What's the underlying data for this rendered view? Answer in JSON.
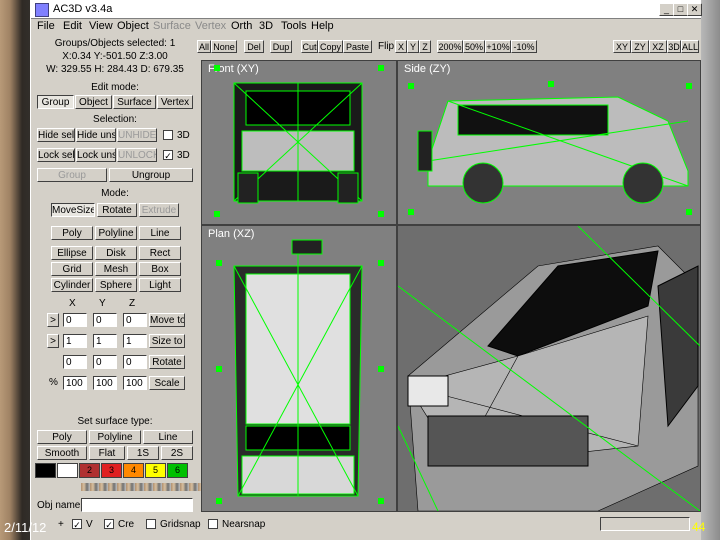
{
  "window": {
    "title": "AC3D v3.4a"
  },
  "menu": [
    "File",
    "Edit",
    "View",
    "Object",
    "Surface",
    "Vertex",
    "Orth",
    "3D",
    "Tools",
    "Help"
  ],
  "info": {
    "selected": "Groups/Objects selected: 1",
    "coords": "X:0.34 Y:-501.50 Z:3.00",
    "size": "W: 329.55 H: 284.43 D: 679.35"
  },
  "edit_mode": {
    "label": "Edit mode:",
    "buttons": [
      "Group",
      "Object",
      "Surface",
      "Vertex"
    ]
  },
  "selection": {
    "label": "Selection:",
    "row1": [
      "Hide sel",
      "Hide unse",
      "UNHIDE"
    ],
    "row2": [
      "Lock sel",
      "Lock unse",
      "UNLOCK"
    ],
    "three_d": "3D",
    "group": "Group",
    "ungroup": "Ungroup"
  },
  "mode": {
    "label": "Mode:",
    "buttons": [
      "MoveSize",
      "Rotate",
      "Extrude"
    ]
  },
  "create": [
    "Poly",
    "Polyline",
    "Line",
    "Ellipse",
    "Disk",
    "Rect",
    "Grid",
    "Mesh",
    "Box",
    "Cylinder",
    "Sphere",
    "Light"
  ],
  "transform": {
    "headers": [
      "X",
      "Y",
      "Z"
    ],
    "rows": [
      {
        "arrow": ">",
        "vals": [
          "0",
          "0",
          "0"
        ],
        "action": "Move to"
      },
      {
        "arrow": ">",
        "vals": [
          "1",
          "1",
          "1"
        ],
        "action": "Size to"
      },
      {
        "arrow": "",
        "vals": [
          "0",
          "0",
          "0"
        ],
        "action": "Rotate"
      },
      {
        "arrow": "%",
        "vals": [
          "100",
          "100",
          "100"
        ],
        "action": "Scale"
      }
    ]
  },
  "surface": {
    "label": "Set surface type:",
    "row1": [
      "Poly",
      "Polyline",
      "Line"
    ],
    "row2": [
      "Smooth",
      "Flat",
      "1S",
      "2S"
    ]
  },
  "palette": {
    "swatches": [
      "",
      "",
      "2",
      "3",
      "4",
      "5",
      "6"
    ],
    "colors": [
      "#000000",
      "#ffffff",
      "#b03030",
      "#e02020",
      "#ff8800",
      "#ffff00",
      "#00c000"
    ]
  },
  "obj_name": {
    "label": "Obj name:"
  },
  "toolbar": {
    "buttons1": [
      "All",
      "None",
      "Del",
      "Dup",
      "Cut",
      "Copy",
      "Paste"
    ],
    "flip_label": "Flip:",
    "flip": [
      "X",
      "Y",
      "Z"
    ],
    "zoom": [
      "200%",
      "50%",
      "+10%",
      "-10%"
    ],
    "views": [
      "XY",
      "ZY",
      "XZ",
      "3D",
      "ALL"
    ]
  },
  "viewports": {
    "front": "Front (XY)",
    "side": "Side (ZY)",
    "plan": "Plan (XZ)"
  },
  "status": {
    "items": [
      "+",
      "V",
      "Cre",
      "Gridsnap",
      "Nearsnap"
    ]
  },
  "slide": {
    "date": "2/11/12",
    "number": "44"
  },
  "colors": {
    "wire": "#00ff00",
    "viewport_bg": "#808080"
  }
}
